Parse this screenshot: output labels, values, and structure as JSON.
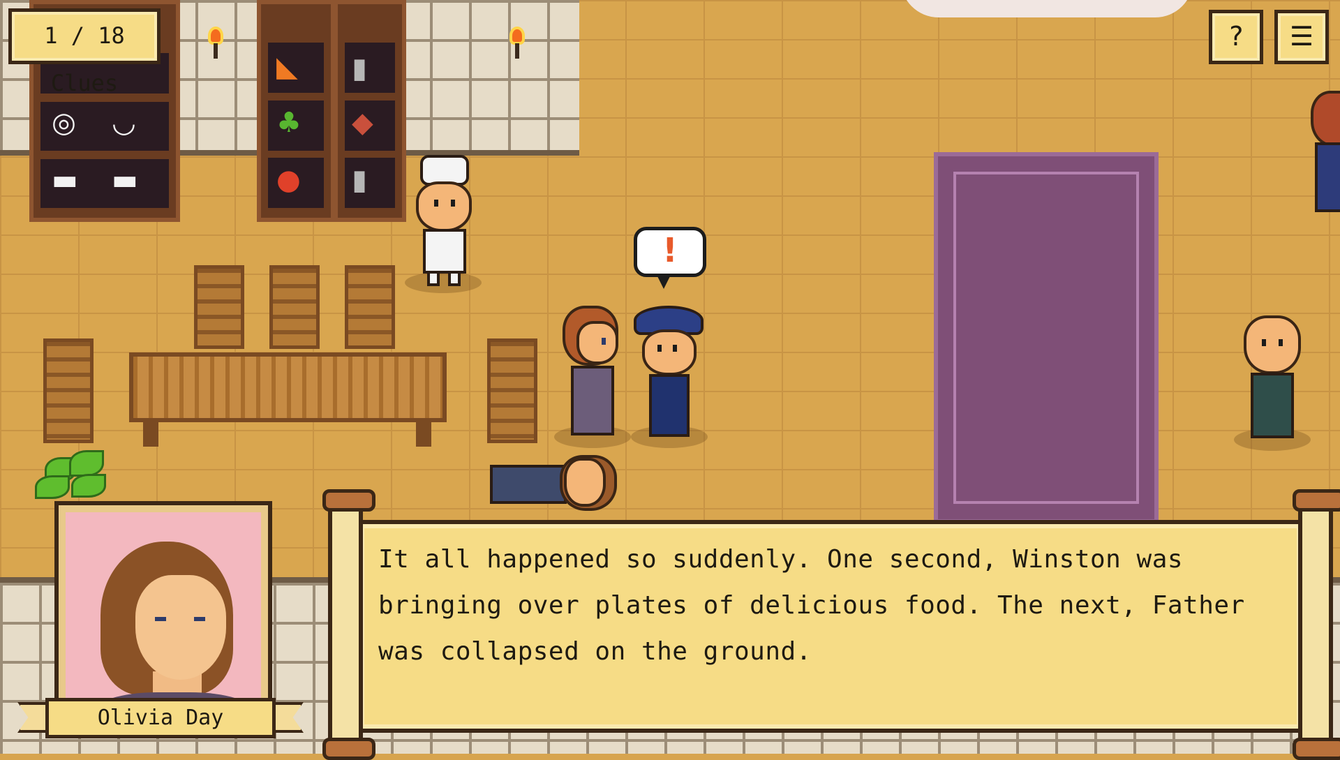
{
  "hud": {
    "clues_label": "1 / 18 Clues",
    "help_icon": "?",
    "menu_icon": "☰"
  },
  "dialog": {
    "speaker": "Olivia Day",
    "text": "It all happened so suddenly. One second, Winston was bringing over plates of delicious food. The next, Father was collapsed on the ground."
  },
  "scene": {
    "alert_mark": "!"
  },
  "colors": {
    "floor": "#d9a64f",
    "panel": "#f6dc86",
    "panel_border": "#3b2716",
    "rug": "#7f4f77",
    "portrait_bg": "#f3b8bf",
    "alert": "#e85a2b"
  }
}
